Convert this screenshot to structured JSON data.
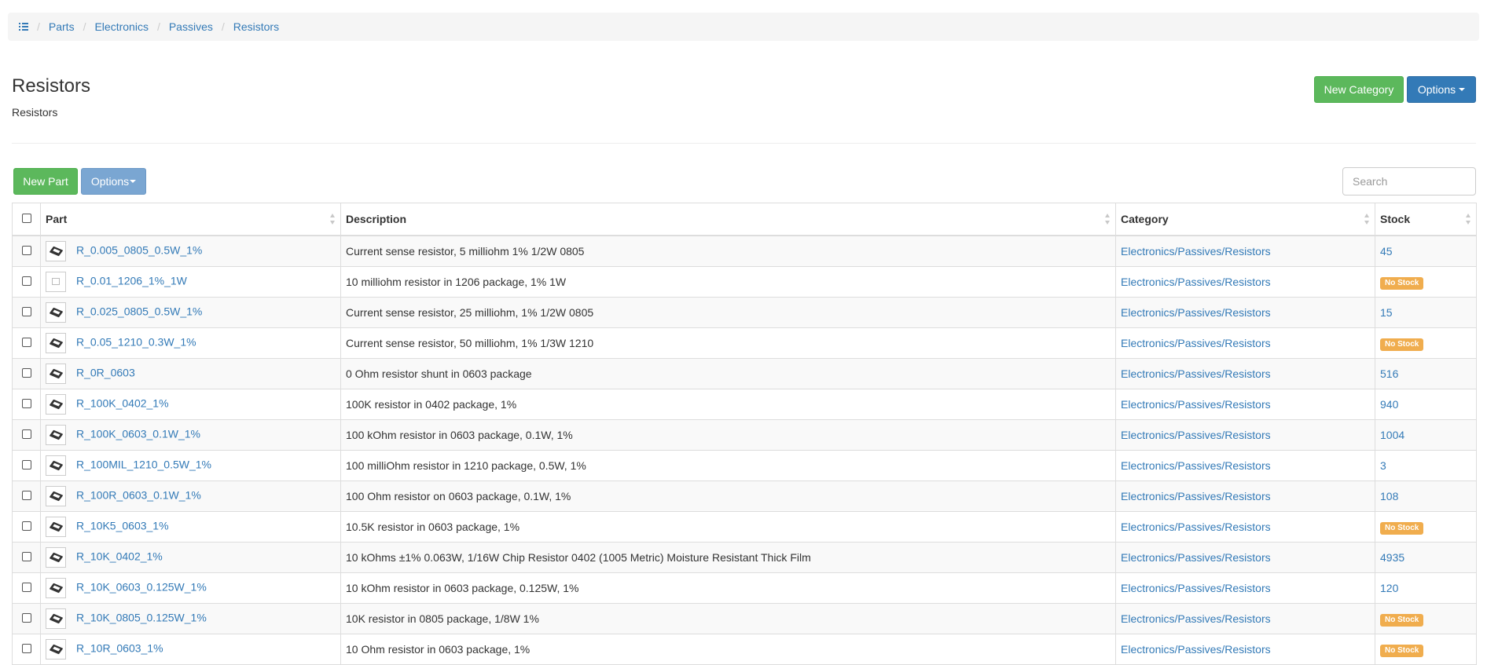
{
  "breadcrumb": {
    "items": [
      "Parts",
      "Electronics",
      "Passives",
      "Resistors"
    ]
  },
  "header": {
    "title": "Resistors",
    "subtitle": "Resistors",
    "new_category_label": "New Category",
    "options_label": "Options"
  },
  "toolbar": {
    "new_part_label": "New Part",
    "options_label": "Options",
    "search_placeholder": "Search"
  },
  "table": {
    "columns": [
      "Part",
      "Description",
      "Category",
      "Stock"
    ],
    "rows": [
      {
        "part": "R_0.005_0805_0.5W_1%",
        "desc": "Current sense resistor, 5 milliohm 1% 1/2W 0805",
        "category": "Electronics/Passives/Resistors",
        "stock": "45",
        "thumb": "chip"
      },
      {
        "part": "R_0.01_1206_1%_1W",
        "desc": "10 milliohm resistor in 1206 package, 1% 1W",
        "category": "Electronics/Passives/Resistors",
        "stock": "No Stock",
        "thumb": "placeholder"
      },
      {
        "part": "R_0.025_0805_0.5W_1%",
        "desc": "Current sense resistor, 25 milliohm, 1% 1/2W 0805",
        "category": "Electronics/Passives/Resistors",
        "stock": "15",
        "thumb": "chip"
      },
      {
        "part": "R_0.05_1210_0.3W_1%",
        "desc": "Current sense resistor, 50 milliohm, 1% 1/3W 1210",
        "category": "Electronics/Passives/Resistors",
        "stock": "No Stock",
        "thumb": "chip"
      },
      {
        "part": "R_0R_0603",
        "desc": "0 Ohm resistor shunt in 0603 package",
        "category": "Electronics/Passives/Resistors",
        "stock": "516",
        "thumb": "chip"
      },
      {
        "part": "R_100K_0402_1%",
        "desc": "100K resistor in 0402 package, 1%",
        "category": "Electronics/Passives/Resistors",
        "stock": "940",
        "thumb": "chip"
      },
      {
        "part": "R_100K_0603_0.1W_1%",
        "desc": "100 kOhm resistor in 0603 package, 0.1W, 1%",
        "category": "Electronics/Passives/Resistors",
        "stock": "1004",
        "thumb": "chip"
      },
      {
        "part": "R_100MIL_1210_0.5W_1%",
        "desc": "100 milliOhm resistor in 1210 package, 0.5W, 1%",
        "category": "Electronics/Passives/Resistors",
        "stock": "3",
        "thumb": "chip"
      },
      {
        "part": "R_100R_0603_0.1W_1%",
        "desc": "100 Ohm resistor on 0603 package, 0.1W, 1%",
        "category": "Electronics/Passives/Resistors",
        "stock": "108",
        "thumb": "chip"
      },
      {
        "part": "R_10K5_0603_1%",
        "desc": "10.5K resistor in 0603 package, 1%",
        "category": "Electronics/Passives/Resistors",
        "stock": "No Stock",
        "thumb": "chip"
      },
      {
        "part": "R_10K_0402_1%",
        "desc": "10 kOhms ±1% 0.063W, 1/16W Chip Resistor 0402 (1005 Metric) Moisture Resistant Thick Film",
        "category": "Electronics/Passives/Resistors",
        "stock": "4935",
        "thumb": "chip"
      },
      {
        "part": "R_10K_0603_0.125W_1%",
        "desc": "10 kOhm resistor in 0603 package, 0.125W, 1%",
        "category": "Electronics/Passives/Resistors",
        "stock": "120",
        "thumb": "chip"
      },
      {
        "part": "R_10K_0805_0.125W_1%",
        "desc": "10K resistor in 0805 package, 1/8W 1%",
        "category": "Electronics/Passives/Resistors",
        "stock": "No Stock",
        "thumb": "chip"
      },
      {
        "part": "R_10R_0603_1%",
        "desc": "10 Ohm resistor in 0603 package, 1%",
        "category": "Electronics/Passives/Resistors",
        "stock": "No Stock",
        "thumb": "chip"
      }
    ]
  }
}
